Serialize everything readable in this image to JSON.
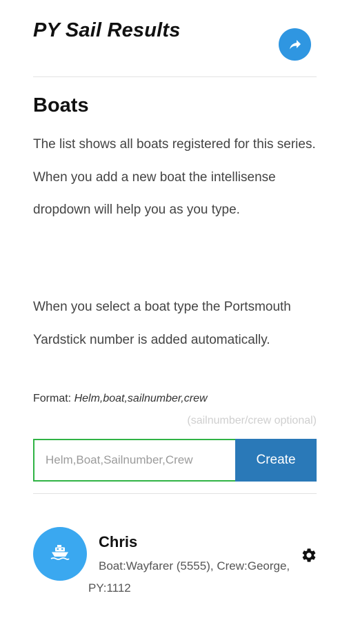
{
  "header": {
    "app_title": "PY Sail Results",
    "share_icon": "share-arrow-icon",
    "accent_color": "#2f96e1"
  },
  "boats_section": {
    "heading": "Boats",
    "paragraph1": "The list shows all boats registered for this series. When you add a new boat the intellisense dropdown will help you as you type.",
    "paragraph2": "When you select a boat type the Portsmouth Yardstick number is added automatically.",
    "format_label": "Format: ",
    "format_example": "Helm,boat,sailnumber,crew",
    "format_optional": "(sailnumber/crew optional)"
  },
  "entry": {
    "placeholder": "Helm,Boat,Sailnumber,Crew",
    "value": "",
    "create_label": "Create",
    "input_border_color": "#2fb344",
    "button_color": "#2a79b8"
  },
  "boats": [
    {
      "helm": "Chris",
      "details": "Boat:Wayfarer (5555), Crew:George, PY:1112",
      "avatar_icon": "boat-icon",
      "settings_icon": "gear-icon",
      "avatar_color": "#3aa8f0"
    }
  ]
}
